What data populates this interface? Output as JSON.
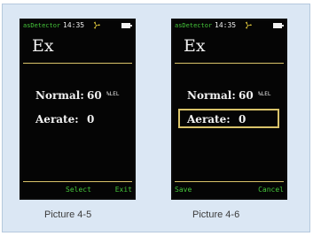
{
  "colors": {
    "panel_bg": "#dbe7f4",
    "screen_bg": "#050505",
    "status_green": "#45c53a",
    "highlight_gold": "#d9c36a",
    "text_white": "#f0f0f0"
  },
  "screens": [
    {
      "status": {
        "app_name": "asDetector",
        "time": "14:35",
        "icons": [
          "fan-icon",
          "battery-icon"
        ]
      },
      "title": "Ex",
      "rows": [
        {
          "label": "Normal:",
          "value": "60",
          "unit": "%LEL"
        },
        {
          "label": "Aerate:",
          "value": "0"
        }
      ],
      "softkeys": {
        "left": "",
        "middle": "Select",
        "right": "Exit"
      },
      "selected_row": null,
      "caption": "Picture 4-5"
    },
    {
      "status": {
        "app_name": "asDetector",
        "time": "14:35",
        "icons": [
          "fan-icon",
          "battery-icon"
        ]
      },
      "title": "Ex",
      "rows": [
        {
          "label": "Normal:",
          "value": "60",
          "unit": "%LEL"
        },
        {
          "label": "Aerate:",
          "value": "0"
        }
      ],
      "softkeys": {
        "left": "Save",
        "middle": "",
        "right": "Cancel"
      },
      "selected_row": "Aerate:",
      "caption": "Picture 4-6"
    }
  ]
}
